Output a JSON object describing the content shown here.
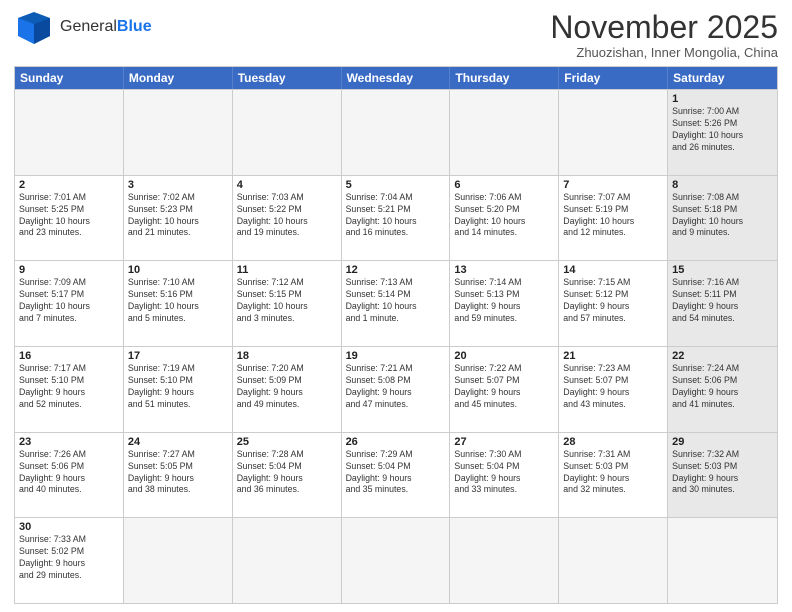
{
  "header": {
    "logo_general": "General",
    "logo_blue": "Blue",
    "month_title": "November 2025",
    "location": "Zhuozishan, Inner Mongolia, China"
  },
  "days_of_week": [
    "Sunday",
    "Monday",
    "Tuesday",
    "Wednesday",
    "Thursday",
    "Friday",
    "Saturday"
  ],
  "weeks": [
    [
      {
        "day": "",
        "info": "",
        "empty": true
      },
      {
        "day": "",
        "info": "",
        "empty": true
      },
      {
        "day": "",
        "info": "",
        "empty": true
      },
      {
        "day": "",
        "info": "",
        "empty": true
      },
      {
        "day": "",
        "info": "",
        "empty": true
      },
      {
        "day": "",
        "info": "",
        "empty": true
      },
      {
        "day": "1",
        "info": "Sunrise: 7:00 AM\nSunset: 5:26 PM\nDaylight: 10 hours\nand 26 minutes.",
        "shaded": true
      }
    ],
    [
      {
        "day": "2",
        "info": "Sunrise: 7:01 AM\nSunset: 5:25 PM\nDaylight: 10 hours\nand 23 minutes.",
        "shaded": false
      },
      {
        "day": "3",
        "info": "Sunrise: 7:02 AM\nSunset: 5:23 PM\nDaylight: 10 hours\nand 21 minutes.",
        "shaded": false
      },
      {
        "day": "4",
        "info": "Sunrise: 7:03 AM\nSunset: 5:22 PM\nDaylight: 10 hours\nand 19 minutes.",
        "shaded": false
      },
      {
        "day": "5",
        "info": "Sunrise: 7:04 AM\nSunset: 5:21 PM\nDaylight: 10 hours\nand 16 minutes.",
        "shaded": false
      },
      {
        "day": "6",
        "info": "Sunrise: 7:06 AM\nSunset: 5:20 PM\nDaylight: 10 hours\nand 14 minutes.",
        "shaded": false
      },
      {
        "day": "7",
        "info": "Sunrise: 7:07 AM\nSunset: 5:19 PM\nDaylight: 10 hours\nand 12 minutes.",
        "shaded": false
      },
      {
        "day": "8",
        "info": "Sunrise: 7:08 AM\nSunset: 5:18 PM\nDaylight: 10 hours\nand 9 minutes.",
        "shaded": true
      }
    ],
    [
      {
        "day": "9",
        "info": "Sunrise: 7:09 AM\nSunset: 5:17 PM\nDaylight: 10 hours\nand 7 minutes.",
        "shaded": false
      },
      {
        "day": "10",
        "info": "Sunrise: 7:10 AM\nSunset: 5:16 PM\nDaylight: 10 hours\nand 5 minutes.",
        "shaded": false
      },
      {
        "day": "11",
        "info": "Sunrise: 7:12 AM\nSunset: 5:15 PM\nDaylight: 10 hours\nand 3 minutes.",
        "shaded": false
      },
      {
        "day": "12",
        "info": "Sunrise: 7:13 AM\nSunset: 5:14 PM\nDaylight: 10 hours\nand 1 minute.",
        "shaded": false
      },
      {
        "day": "13",
        "info": "Sunrise: 7:14 AM\nSunset: 5:13 PM\nDaylight: 9 hours\nand 59 minutes.",
        "shaded": false
      },
      {
        "day": "14",
        "info": "Sunrise: 7:15 AM\nSunset: 5:12 PM\nDaylight: 9 hours\nand 57 minutes.",
        "shaded": false
      },
      {
        "day": "15",
        "info": "Sunrise: 7:16 AM\nSunset: 5:11 PM\nDaylight: 9 hours\nand 54 minutes.",
        "shaded": true
      }
    ],
    [
      {
        "day": "16",
        "info": "Sunrise: 7:17 AM\nSunset: 5:10 PM\nDaylight: 9 hours\nand 52 minutes.",
        "shaded": false
      },
      {
        "day": "17",
        "info": "Sunrise: 7:19 AM\nSunset: 5:10 PM\nDaylight: 9 hours\nand 51 minutes.",
        "shaded": false
      },
      {
        "day": "18",
        "info": "Sunrise: 7:20 AM\nSunset: 5:09 PM\nDaylight: 9 hours\nand 49 minutes.",
        "shaded": false
      },
      {
        "day": "19",
        "info": "Sunrise: 7:21 AM\nSunset: 5:08 PM\nDaylight: 9 hours\nand 47 minutes.",
        "shaded": false
      },
      {
        "day": "20",
        "info": "Sunrise: 7:22 AM\nSunset: 5:07 PM\nDaylight: 9 hours\nand 45 minutes.",
        "shaded": false
      },
      {
        "day": "21",
        "info": "Sunrise: 7:23 AM\nSunset: 5:07 PM\nDaylight: 9 hours\nand 43 minutes.",
        "shaded": false
      },
      {
        "day": "22",
        "info": "Sunrise: 7:24 AM\nSunset: 5:06 PM\nDaylight: 9 hours\nand 41 minutes.",
        "shaded": true
      }
    ],
    [
      {
        "day": "23",
        "info": "Sunrise: 7:26 AM\nSunset: 5:06 PM\nDaylight: 9 hours\nand 40 minutes.",
        "shaded": false
      },
      {
        "day": "24",
        "info": "Sunrise: 7:27 AM\nSunset: 5:05 PM\nDaylight: 9 hours\nand 38 minutes.",
        "shaded": false
      },
      {
        "day": "25",
        "info": "Sunrise: 7:28 AM\nSunset: 5:04 PM\nDaylight: 9 hours\nand 36 minutes.",
        "shaded": false
      },
      {
        "day": "26",
        "info": "Sunrise: 7:29 AM\nSunset: 5:04 PM\nDaylight: 9 hours\nand 35 minutes.",
        "shaded": false
      },
      {
        "day": "27",
        "info": "Sunrise: 7:30 AM\nSunset: 5:04 PM\nDaylight: 9 hours\nand 33 minutes.",
        "shaded": false
      },
      {
        "day": "28",
        "info": "Sunrise: 7:31 AM\nSunset: 5:03 PM\nDaylight: 9 hours\nand 32 minutes.",
        "shaded": false
      },
      {
        "day": "29",
        "info": "Sunrise: 7:32 AM\nSunset: 5:03 PM\nDaylight: 9 hours\nand 30 minutes.",
        "shaded": true
      }
    ],
    [
      {
        "day": "30",
        "info": "Sunrise: 7:33 AM\nSunset: 5:02 PM\nDaylight: 9 hours\nand 29 minutes.",
        "shaded": false
      },
      {
        "day": "",
        "info": "",
        "empty": true
      },
      {
        "day": "",
        "info": "",
        "empty": true
      },
      {
        "day": "",
        "info": "",
        "empty": true
      },
      {
        "day": "",
        "info": "",
        "empty": true
      },
      {
        "day": "",
        "info": "",
        "empty": true
      },
      {
        "day": "",
        "info": "",
        "empty": true
      }
    ]
  ]
}
